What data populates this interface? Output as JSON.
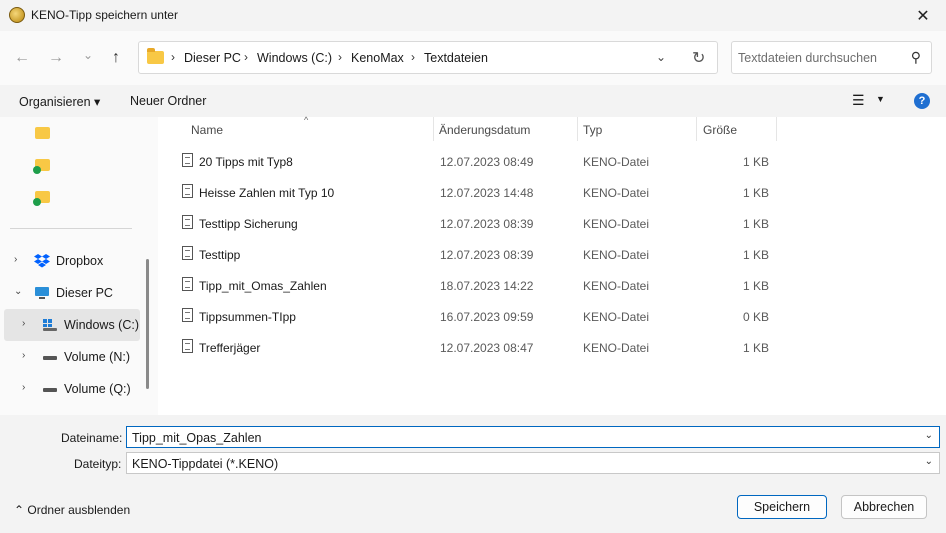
{
  "window": {
    "title": "KENO-Tipp speichern unter",
    "close_glyph": "✕"
  },
  "nav": {
    "back_glyph": "←",
    "forward_glyph": "→",
    "recent_glyph": "⌄",
    "up_glyph": "↑",
    "breadcrumb": [
      "Dieser PC",
      "Windows (C:)",
      "KenoMax",
      "Textdateien"
    ],
    "sep_glyph": "›",
    "dropdown_glyph": "⌄",
    "refresh_glyph": "↻",
    "search_placeholder": "Textdateien durchsuchen",
    "search_glyph": "⚲"
  },
  "commandbar": {
    "organize_label": "Organisieren ▾",
    "new_folder_label": "Neuer Ordner",
    "view_glyph": "☰",
    "view_dd_glyph": "▼",
    "help_glyph": "?"
  },
  "sidebar": {
    "items": [
      {
        "label": "Dropbox",
        "chevron": "›"
      },
      {
        "label": "Dieser PC",
        "chevron": "⌄"
      },
      {
        "label": "Windows (C:)",
        "chevron": "›"
      },
      {
        "label": "Volume (N:)",
        "chevron": "›"
      },
      {
        "label": "Volume (Q:)",
        "chevron": "›"
      }
    ]
  },
  "filelist": {
    "columns": {
      "name": "Name",
      "date": "Änderungsdatum",
      "type": "Typ",
      "size": "Größe"
    },
    "sort_glyph": "^",
    "rows": [
      {
        "name": "20 Tipps mit Typ8",
        "date": "12.07.2023 08:49",
        "type": "KENO-Datei",
        "size": "1 KB"
      },
      {
        "name": "Heisse Zahlen mit Typ 10",
        "date": "12.07.2023 14:48",
        "type": "KENO-Datei",
        "size": "1 KB"
      },
      {
        "name": "Testtipp Sicherung",
        "date": "12.07.2023 08:39",
        "type": "KENO-Datei",
        "size": "1 KB"
      },
      {
        "name": "Testtipp",
        "date": "12.07.2023 08:39",
        "type": "KENO-Datei",
        "size": "1 KB"
      },
      {
        "name": "Tipp_mit_Omas_Zahlen",
        "date": "18.07.2023 14:22",
        "type": "KENO-Datei",
        "size": "1 KB"
      },
      {
        "name": "Tippsummen-TIpp",
        "date": "16.07.2023 09:59",
        "type": "KENO-Datei",
        "size": "0 KB"
      },
      {
        "name": "Trefferjäger",
        "date": "12.07.2023 08:47",
        "type": "KENO-Datei",
        "size": "1 KB"
      }
    ]
  },
  "form": {
    "filename_label": "Dateiname:",
    "filename_value": "Tipp_mit_Opas_Zahlen",
    "filetype_label": "Dateityp:",
    "filetype_value": "KENO-Tippdatei (*.KENO)",
    "dd_glyph": "⌄"
  },
  "footer": {
    "hide_folders_label": "⌃  Ordner ausblenden",
    "save_label": "Speichern",
    "cancel_label": "Abbrechen"
  },
  "colors": {
    "accent": "#0067c0",
    "folder": "#f8c845",
    "help": "#1f6fd1"
  }
}
